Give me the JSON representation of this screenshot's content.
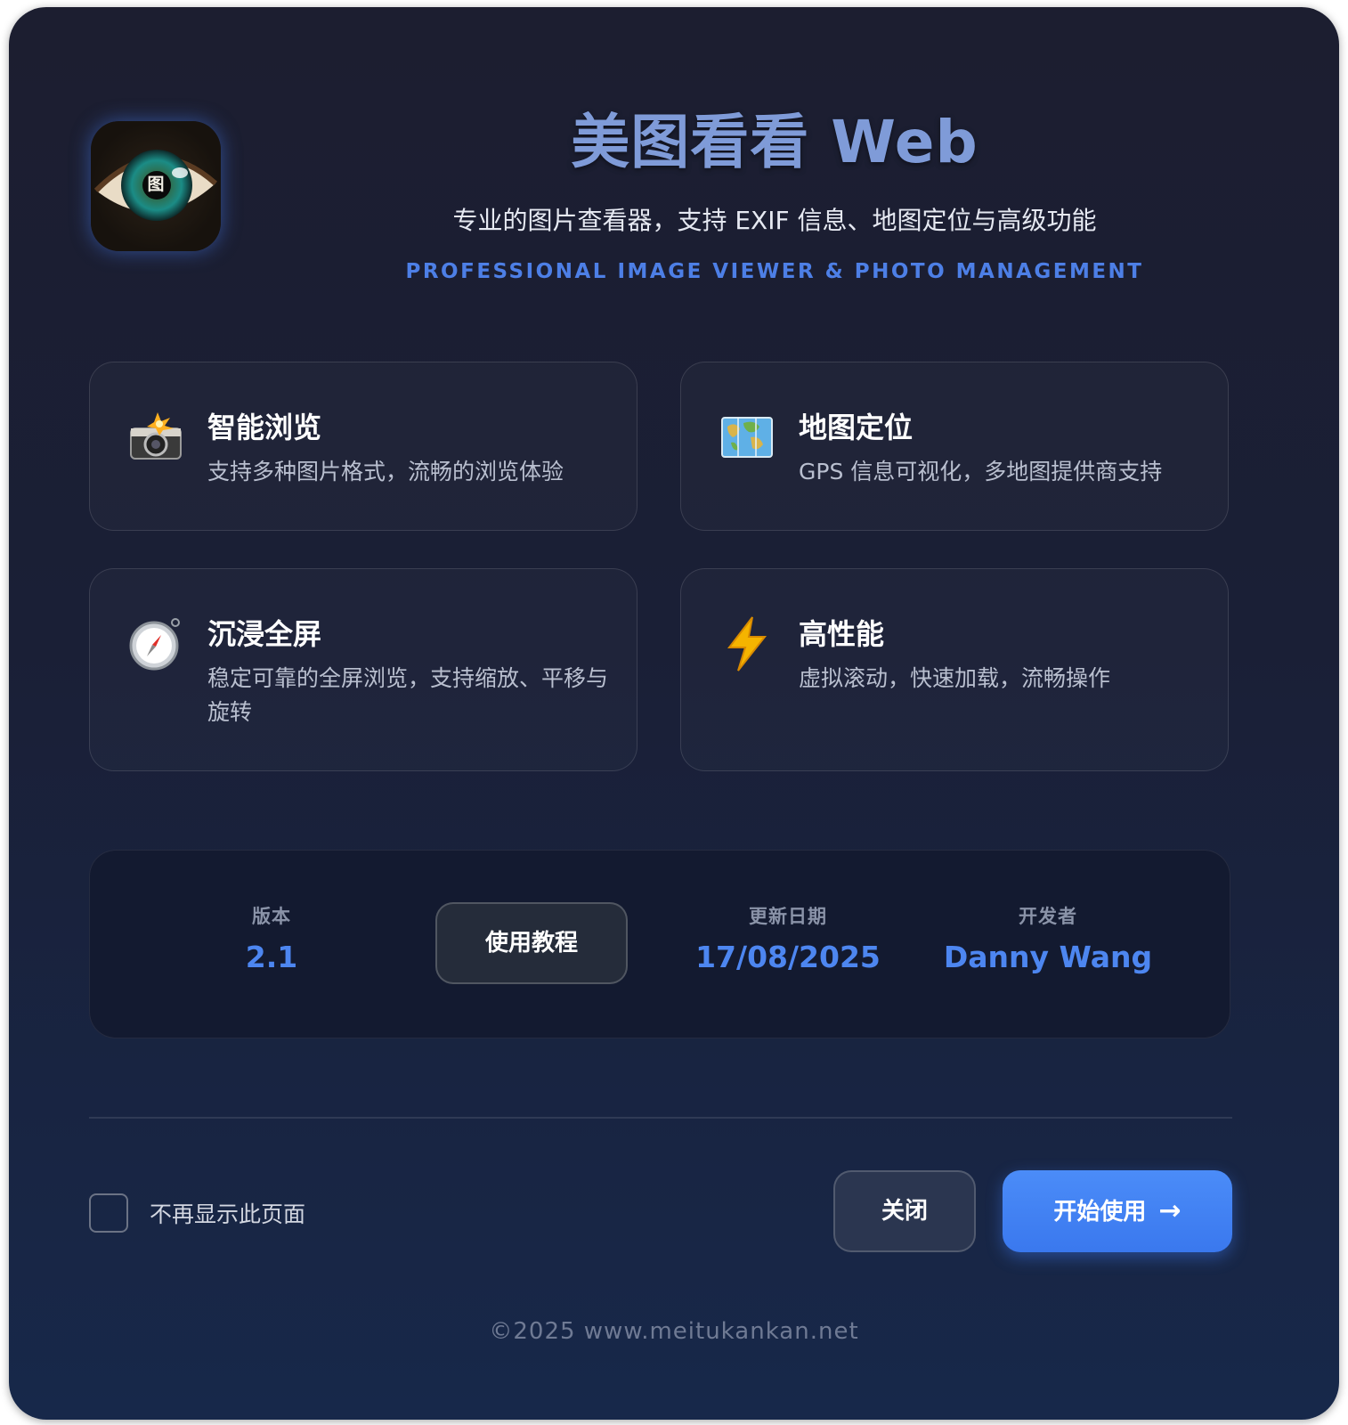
{
  "app": {
    "title": "美图看看 Web",
    "subtitle": "专业的图片查看器，支持 EXIF 信息、地图定位与高级功能",
    "subtitle_en": "PROFESSIONAL IMAGE VIEWER & PHOTO MANAGEMENT",
    "logo_text": "图"
  },
  "features": [
    {
      "icon": "camera-flash-icon",
      "title": "智能浏览",
      "desc": "支持多种图片格式，流畅的浏览体验"
    },
    {
      "icon": "world-map-icon",
      "title": "地图定位",
      "desc": "GPS 信息可视化，多地图提供商支持"
    },
    {
      "icon": "compass-icon",
      "title": "沉浸全屏",
      "desc": "稳定可靠的全屏浏览，支持缩放、平移与旋转"
    },
    {
      "icon": "lightning-icon",
      "title": "高性能",
      "desc": "虚拟滚动，快速加载，流畅操作"
    }
  ],
  "info": {
    "version_label": "版本",
    "version_value": "2.1",
    "tutorial_label": "使用教程",
    "date_label": "更新日期",
    "date_value": "17/08/2025",
    "developer_label": "开发者",
    "developer_value": "Danny Wang"
  },
  "footer_actions": {
    "dont_show_label": "不再显示此页面",
    "dont_show_checked": false,
    "close_label": "关闭",
    "start_label": "开始使用",
    "start_arrow": "→"
  },
  "copyright": "©2025 www.meitukankan.net",
  "colors": {
    "accent": "#3a78ee",
    "title": "#7f9bd8",
    "value": "#4d86f0",
    "background": "#1a1f36"
  }
}
